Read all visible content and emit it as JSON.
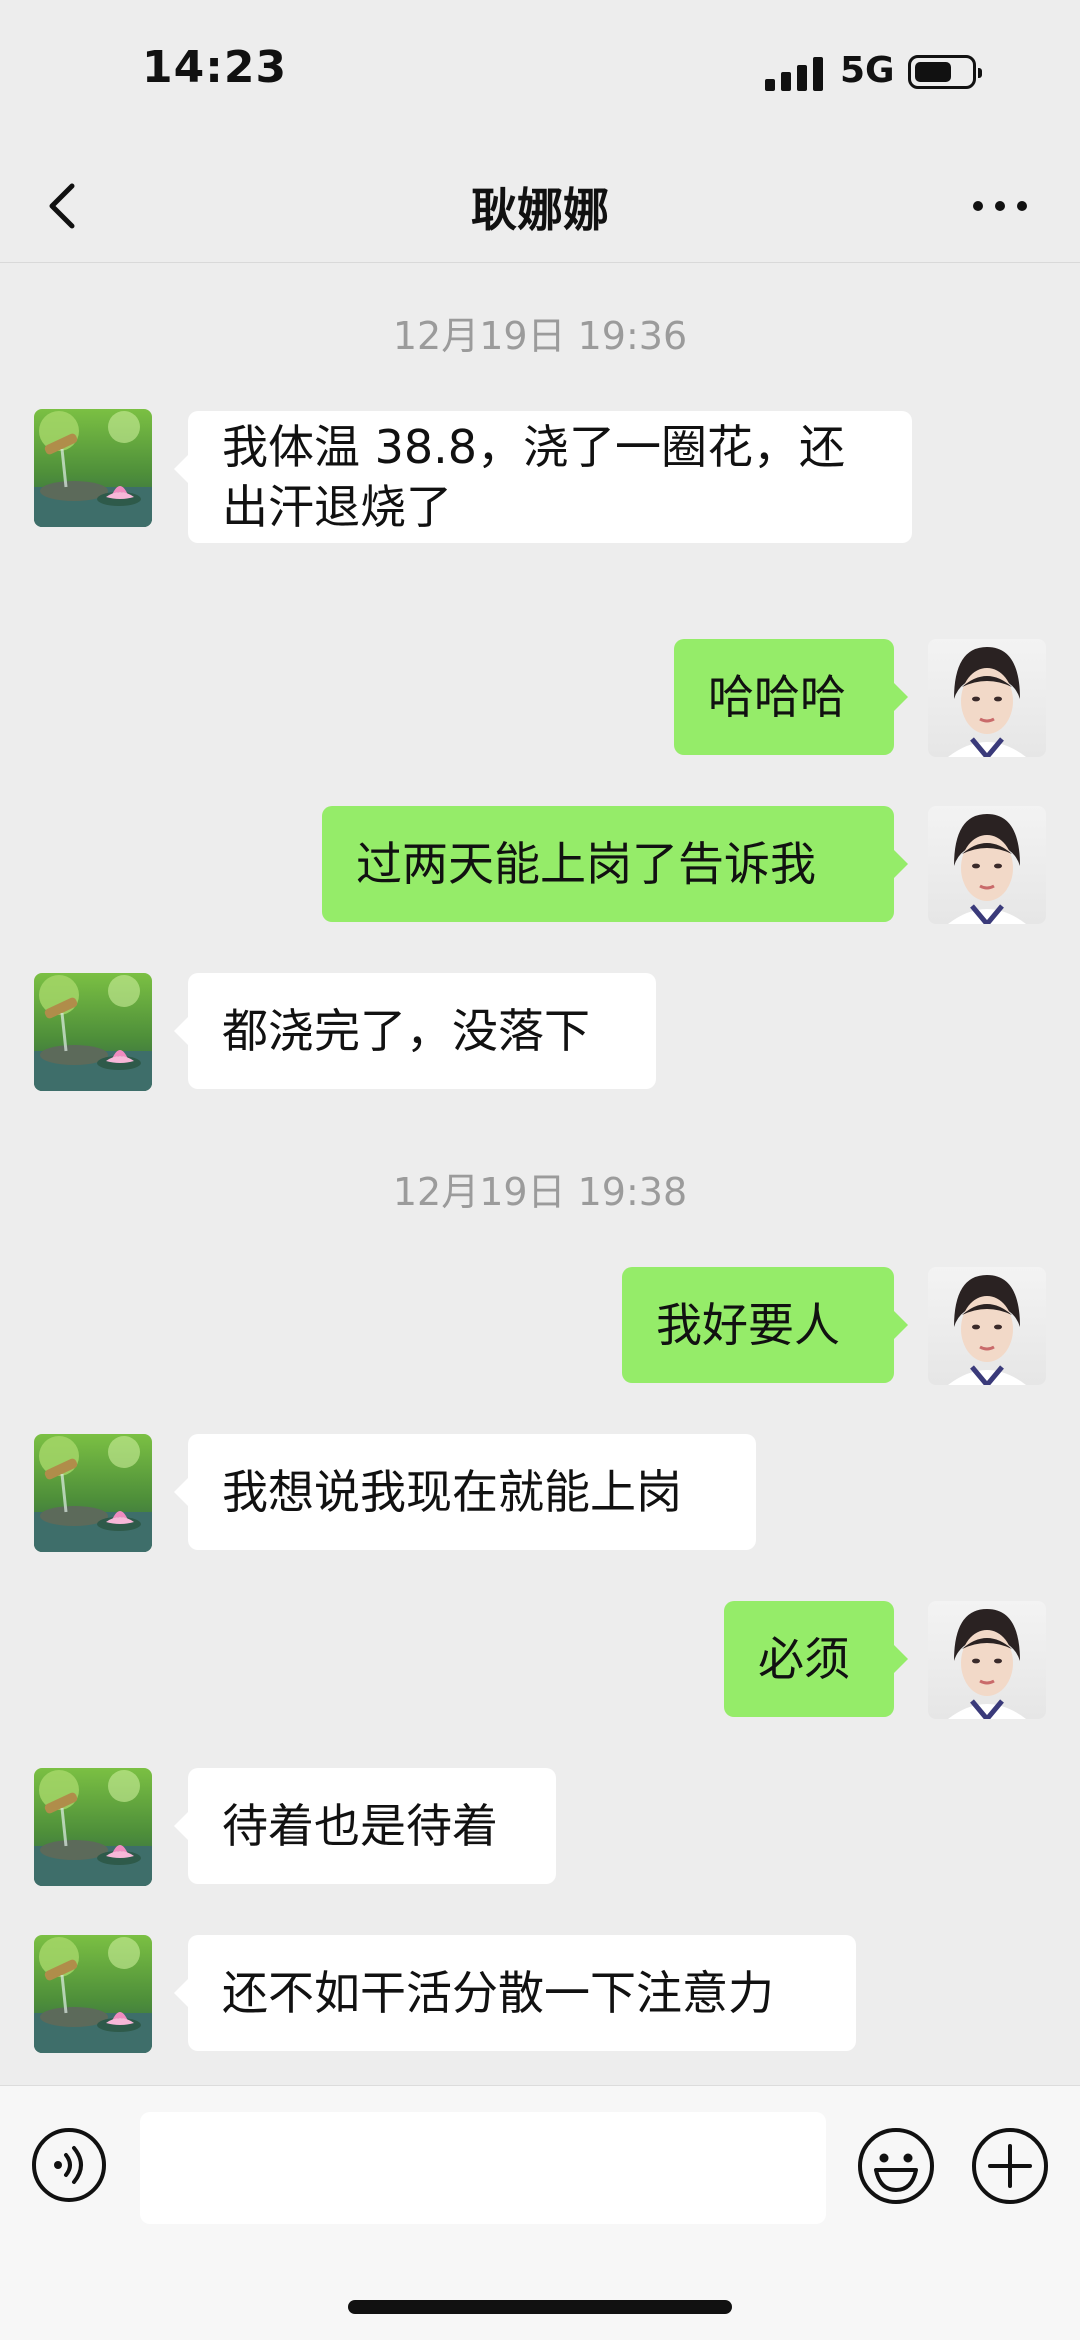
{
  "status_bar": {
    "time": "14:23",
    "network": "5G"
  },
  "header": {
    "title": "耿娜娜"
  },
  "icons": {
    "back": "chevron-left-icon",
    "more": "more-dots-icon",
    "voice": "voice-input-icon",
    "emoji": "emoji-icon",
    "plus": "plus-icon"
  },
  "colors": {
    "sent_bubble": "#95ec69",
    "received_bubble": "#ffffff",
    "background": "#ededed"
  },
  "timestamps": [
    "12月19日 19:36",
    "12月19日 19:38"
  ],
  "messages": [
    {
      "from": "other",
      "text": "我体温 38.8，浇了一圈花，还出汗退烧了"
    },
    {
      "from": "me",
      "text": "哈哈哈"
    },
    {
      "from": "me",
      "text": "过两天能上岗了告诉我"
    },
    {
      "from": "other",
      "text": "都浇完了，没落下"
    },
    {
      "from": "me",
      "text": "我好要人"
    },
    {
      "from": "other",
      "text": "我想说我现在就能上岗"
    },
    {
      "from": "me",
      "text": "必须"
    },
    {
      "from": "other",
      "text": "待着也是待着"
    },
    {
      "from": "other",
      "text": "还不如干活分散一下注意力"
    }
  ],
  "input": {
    "value": ""
  }
}
